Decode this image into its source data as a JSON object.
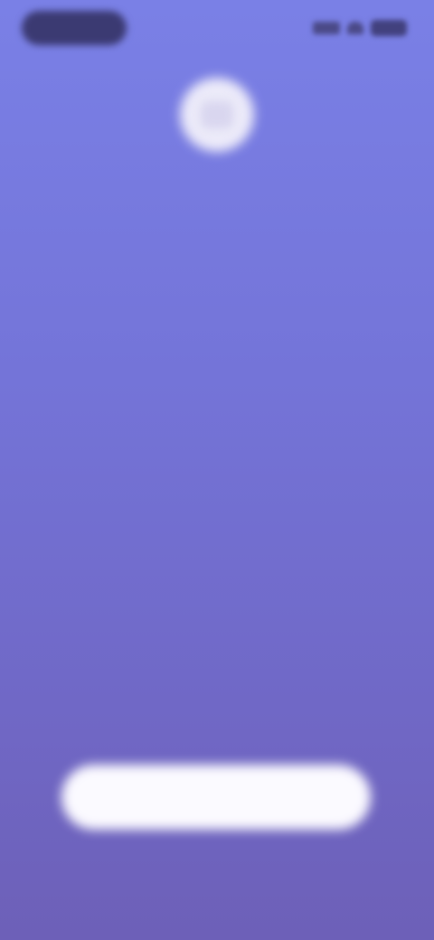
{
  "status_bar": {
    "time": "",
    "signal_icon": "signal-icon",
    "wifi_icon": "wifi-icon",
    "battery_icon": "battery-icon"
  },
  "header": {
    "app_icon": "app-logo-icon",
    "headline_line1": "",
    "headline_line2": ""
  },
  "main": {
    "center_label": ""
  },
  "cta": {
    "label": ""
  },
  "footer": {
    "link_label": ""
  },
  "colors": {
    "background_top": "#7a80e6",
    "background_bottom": "#6d60b8",
    "button": "#fbfaff"
  }
}
